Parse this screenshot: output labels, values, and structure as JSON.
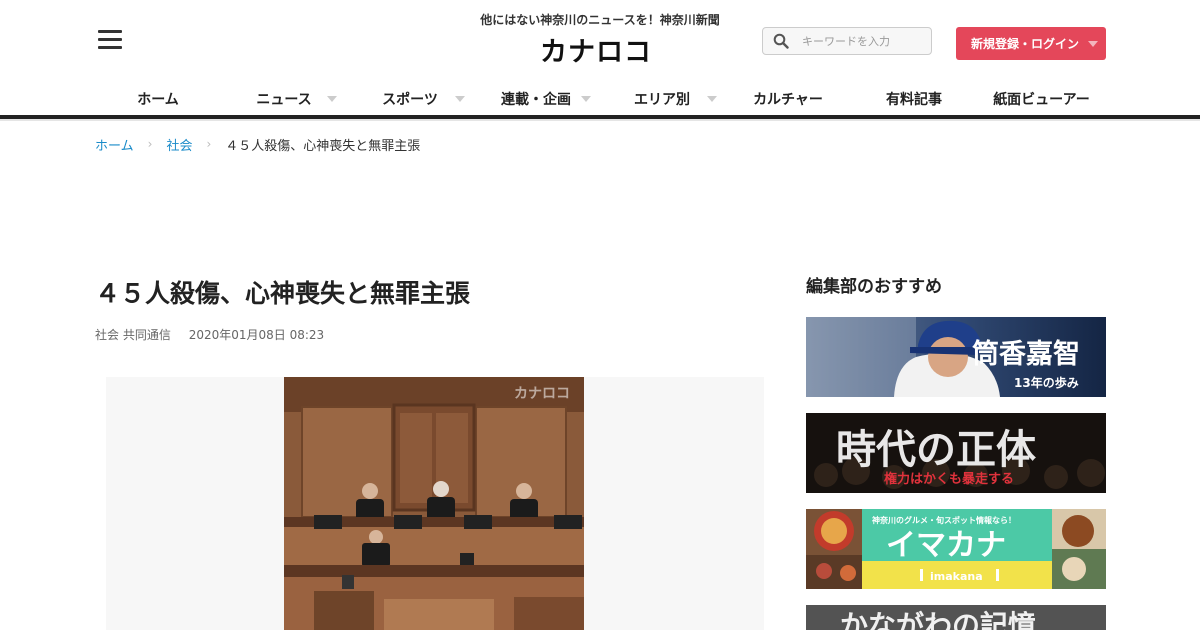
{
  "header": {
    "tagline": "他にはない神奈川のニュースを！神奈川新聞",
    "logo_text": "カナロコ",
    "search_placeholder": "キーワードを入力",
    "login_label": "新規登録・ログイン"
  },
  "nav": {
    "items": [
      {
        "label": "ホーム",
        "dropdown": false
      },
      {
        "label": "ニュース",
        "dropdown": true
      },
      {
        "label": "スポーツ",
        "dropdown": true
      },
      {
        "label": "連載・企画",
        "dropdown": true
      },
      {
        "label": "エリア別",
        "dropdown": true
      },
      {
        "label": "カルチャー",
        "dropdown": false
      },
      {
        "label": "有料記事",
        "dropdown": false
      },
      {
        "label": "紙面ビューアー",
        "dropdown": false
      }
    ]
  },
  "breadcrumb": {
    "home": "ホーム",
    "category": "社会",
    "current": "４５人殺傷、心神喪失と無罪主張"
  },
  "article": {
    "title": "４５人殺傷、心神喪失と無罪主張",
    "category": "社会",
    "source": "共同通信",
    "datetime": "2020年01月08日 08:23",
    "photo_watermark": "カナロコ"
  },
  "sidebar": {
    "heading": "編集部のおすすめ",
    "promos": [
      {
        "title": "筒香嘉智",
        "subtitle": "13年の歩み"
      },
      {
        "title": "時代の正体",
        "subtitle": "権力はかくも暴走する"
      },
      {
        "kicker": "神奈川のグルメ・旬スポット情報なら！",
        "title": "イマカナ",
        "subtitle": "imakana"
      },
      {
        "title": "かながわの記憶"
      }
    ]
  },
  "colors": {
    "accent": "#e4475a",
    "link": "#1a8bc9",
    "nav_rule": "#222222",
    "imakana_green": "#4cc9a6",
    "imakana_yellow": "#f2e24a"
  }
}
